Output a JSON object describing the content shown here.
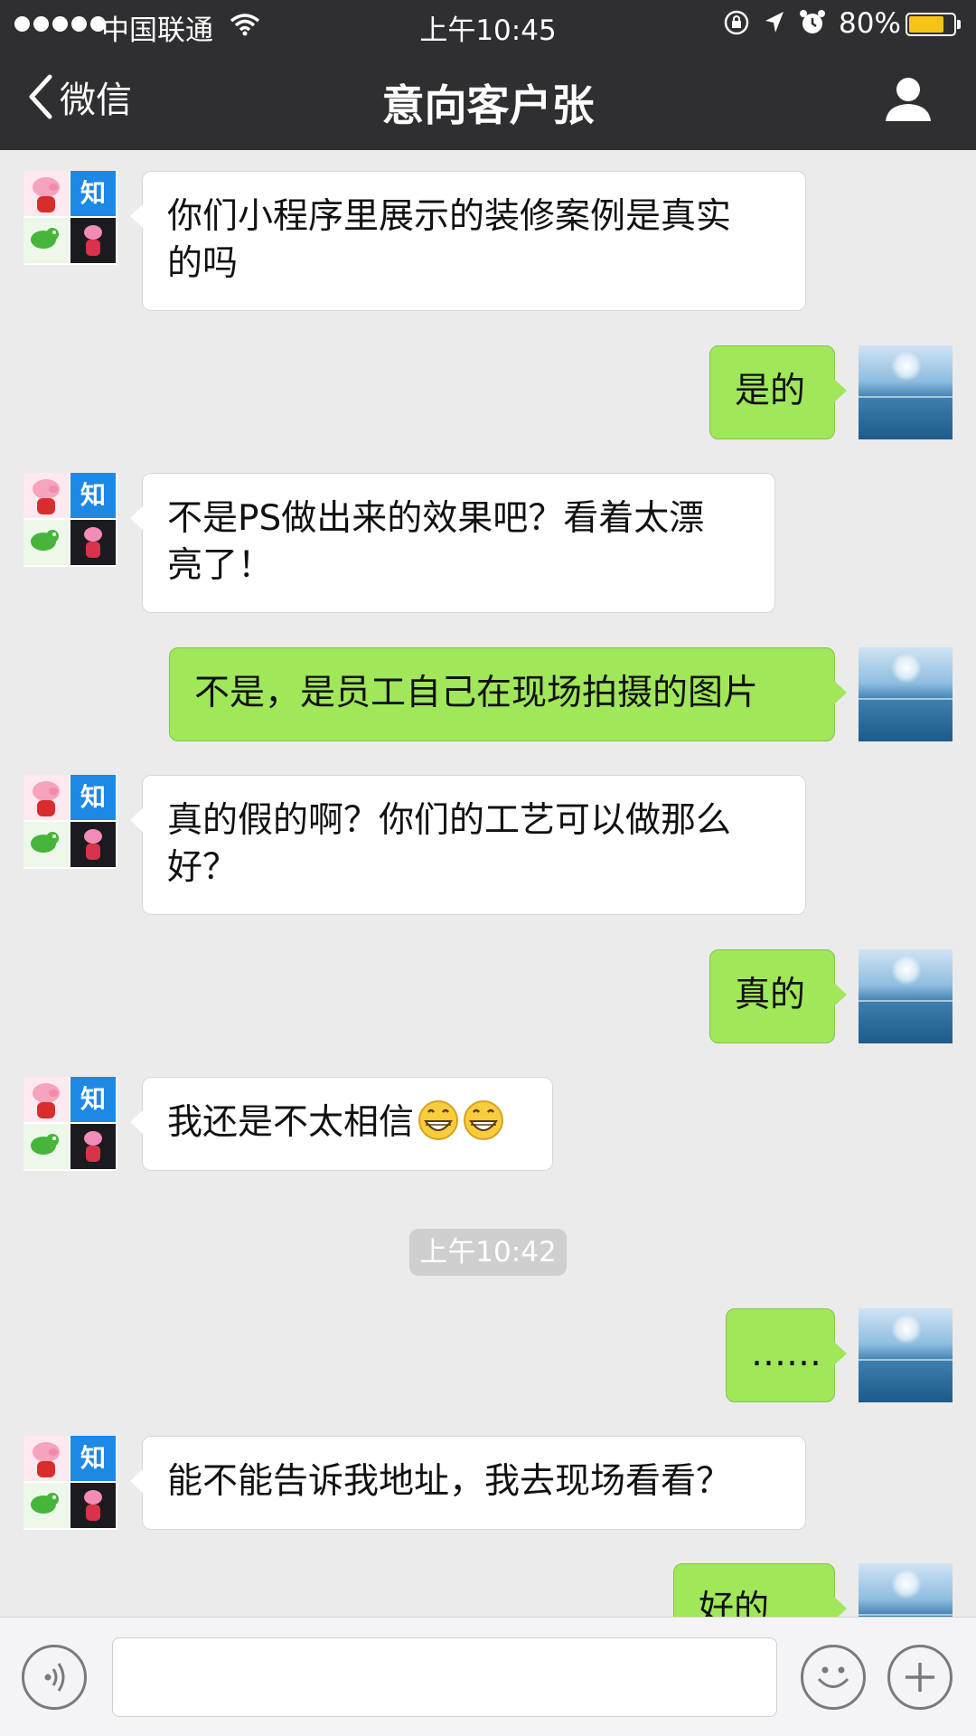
{
  "status_bar": {
    "carrier": "中国联通",
    "time": "上午10:45",
    "battery_text": "80%",
    "battery_level": 0.8,
    "battery_color": "#f6c415",
    "icons": [
      "signal-dots-icon",
      "wifi-icon",
      "orientation-lock-icon",
      "location-arrow-icon",
      "alarm-icon",
      "battery-icon"
    ]
  },
  "nav": {
    "back_label": "微信",
    "title": "意向客户张",
    "icons": [
      "chevron-left-icon",
      "profile-icon"
    ]
  },
  "colors": {
    "nav_background": "#2f2f32",
    "chat_background": "#ebebeb",
    "outgoing_bubble": "#a0e75a",
    "incoming_bubble": "#ffffff"
  },
  "messages": [
    {
      "side": "in",
      "lines": [
        "你们小程序里展示的装修案例是真实",
        "的吗"
      ]
    },
    {
      "side": "out",
      "lines": [
        "是的"
      ]
    },
    {
      "side": "in",
      "lines": [
        "不是PS做出来的效果吧？看着太漂",
        "亮了！"
      ]
    },
    {
      "side": "out",
      "lines": [
        "不是，是员工自己在现场拍摄的图片"
      ]
    },
    {
      "side": "in",
      "lines": [
        "真的假的啊？你们的工艺可以做那么",
        "好？"
      ]
    },
    {
      "side": "out",
      "lines": [
        "真的"
      ]
    },
    {
      "side": "in",
      "lines": [
        "我还是不太相信"
      ],
      "emoji": [
        "grinning-face-icon",
        "grinning-face-icon"
      ]
    },
    {
      "side": "out",
      "lines": [
        "……"
      ]
    },
    {
      "side": "in",
      "lines": [
        "能不能告诉我地址，我去现场看看？"
      ]
    },
    {
      "side": "out",
      "lines": [
        "好的"
      ]
    }
  ],
  "time_separator": "上午10:42",
  "input_bar": {
    "text_value": "",
    "icons": [
      "voice-icon",
      "emoji-icon",
      "plus-icon"
    ]
  }
}
